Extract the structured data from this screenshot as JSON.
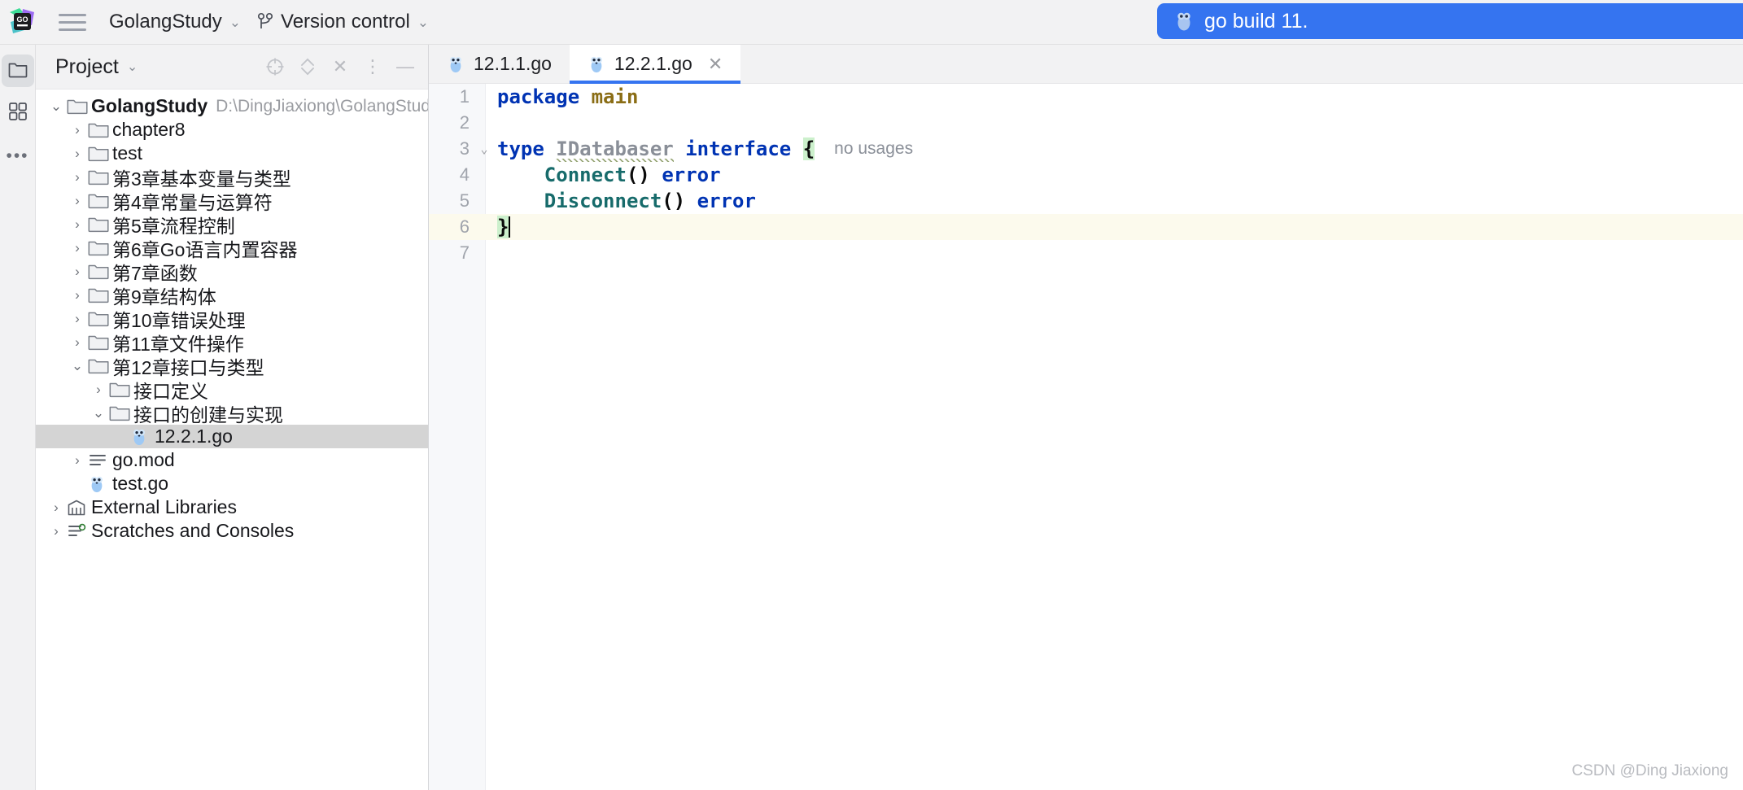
{
  "toolbar": {
    "project_name": "GolangStudy",
    "version_control": "Version control",
    "chevron": "⌄",
    "run_config": "go build 11.",
    "logo_text": "GO"
  },
  "rail": {
    "items": [
      {
        "name": "project-folder",
        "icon": "folder-icon"
      },
      {
        "name": "structure",
        "icon": "grid-icon"
      },
      {
        "name": "more",
        "icon": "ellipsis-icon",
        "glyph": "•••"
      }
    ]
  },
  "panel": {
    "title": "Project",
    "chevron": "⌄",
    "tools": {
      "locate": "crosshair-icon",
      "expand": "expand-collapse-icon",
      "close": "✕",
      "options": "⋮",
      "minimize": "—"
    }
  },
  "tree": {
    "items": [
      {
        "arrow": "⌄",
        "icon": "folder-icon",
        "label": "GolangStudy",
        "path": "D:\\DingJiaxiong\\GolangStudy",
        "indent": 0,
        "bold": true,
        "selected": false
      },
      {
        "arrow": "›",
        "icon": "folder-icon",
        "label": "chapter8",
        "path": "",
        "indent": 1,
        "bold": false,
        "selected": false
      },
      {
        "arrow": "›",
        "icon": "folder-icon",
        "label": "test",
        "path": "",
        "indent": 1,
        "bold": false,
        "selected": false
      },
      {
        "arrow": "›",
        "icon": "folder-icon",
        "label": "第3章基本变量与类型",
        "path": "",
        "indent": 1,
        "bold": false,
        "selected": false
      },
      {
        "arrow": "›",
        "icon": "folder-icon",
        "label": "第4章常量与运算符",
        "path": "",
        "indent": 1,
        "bold": false,
        "selected": false
      },
      {
        "arrow": "›",
        "icon": "folder-icon",
        "label": "第5章流程控制",
        "path": "",
        "indent": 1,
        "bold": false,
        "selected": false
      },
      {
        "arrow": "›",
        "icon": "folder-icon",
        "label": "第6章Go语言内置容器",
        "path": "",
        "indent": 1,
        "bold": false,
        "selected": false
      },
      {
        "arrow": "›",
        "icon": "folder-icon",
        "label": "第7章函数",
        "path": "",
        "indent": 1,
        "bold": false,
        "selected": false
      },
      {
        "arrow": "›",
        "icon": "folder-icon",
        "label": "第9章结构体",
        "path": "",
        "indent": 1,
        "bold": false,
        "selected": false
      },
      {
        "arrow": "›",
        "icon": "folder-icon",
        "label": "第10章错误处理",
        "path": "",
        "indent": 1,
        "bold": false,
        "selected": false
      },
      {
        "arrow": "›",
        "icon": "folder-icon",
        "label": "第11章文件操作",
        "path": "",
        "indent": 1,
        "bold": false,
        "selected": false
      },
      {
        "arrow": "⌄",
        "icon": "folder-icon",
        "label": "第12章接口与类型",
        "path": "",
        "indent": 1,
        "bold": false,
        "selected": false
      },
      {
        "arrow": "›",
        "icon": "folder-icon",
        "label": "接口定义",
        "path": "",
        "indent": 2,
        "bold": false,
        "selected": false
      },
      {
        "arrow": "⌄",
        "icon": "folder-icon",
        "label": "接口的创建与实现",
        "path": "",
        "indent": 2,
        "bold": false,
        "selected": false
      },
      {
        "arrow": "",
        "icon": "go-file-icon",
        "label": "12.2.1.go",
        "path": "",
        "indent": 3,
        "bold": false,
        "selected": true
      },
      {
        "arrow": "›",
        "icon": "mod-file-icon",
        "label": "go.mod",
        "path": "",
        "indent": 1,
        "bold": false,
        "selected": false
      },
      {
        "arrow": "",
        "icon": "go-file-icon",
        "label": "test.go",
        "path": "",
        "indent": 1,
        "bold": false,
        "selected": false
      },
      {
        "arrow": "›",
        "icon": "library-icon",
        "label": "External Libraries",
        "path": "",
        "indent": 0,
        "bold": false,
        "selected": false
      },
      {
        "arrow": "›",
        "icon": "scratches-icon",
        "label": "Scratches and Consoles",
        "path": "",
        "indent": 0,
        "bold": false,
        "selected": false
      }
    ]
  },
  "editor": {
    "tabs": [
      {
        "label": "12.1.1.go",
        "active": false,
        "closable": false
      },
      {
        "label": "12.2.1.go",
        "active": true,
        "closable": true
      }
    ],
    "close_glyph": "✕",
    "code": [
      {
        "num": "1",
        "fold": "",
        "highlight": false,
        "tokens": [
          {
            "text": "package",
            "cls": "kw"
          },
          {
            "text": " ",
            "cls": ""
          },
          {
            "text": "main",
            "cls": "pkg"
          }
        ],
        "inlay": ""
      },
      {
        "num": "2",
        "fold": "",
        "highlight": false,
        "tokens": [],
        "inlay": ""
      },
      {
        "num": "3",
        "fold": "⌄",
        "highlight": false,
        "tokens": [
          {
            "text": "type",
            "cls": "kw"
          },
          {
            "text": " ",
            "cls": ""
          },
          {
            "text": "IDatabaser",
            "cls": "ident squiggle"
          },
          {
            "text": " ",
            "cls": ""
          },
          {
            "text": "interface",
            "cls": "kw"
          },
          {
            "text": " ",
            "cls": ""
          },
          {
            "text": "{",
            "cls": "brace-hl"
          }
        ],
        "inlay": "no usages"
      },
      {
        "num": "4",
        "fold": "",
        "highlight": false,
        "tokens": [
          {
            "text": "    ",
            "cls": ""
          },
          {
            "text": "Connect",
            "cls": "fn"
          },
          {
            "text": "()",
            "cls": "punct"
          },
          {
            "text": " ",
            "cls": ""
          },
          {
            "text": "error",
            "cls": "kw"
          }
        ],
        "inlay": ""
      },
      {
        "num": "5",
        "fold": "",
        "highlight": false,
        "tokens": [
          {
            "text": "    ",
            "cls": ""
          },
          {
            "text": "Disconnect",
            "cls": "fn"
          },
          {
            "text": "()",
            "cls": "punct"
          },
          {
            "text": " ",
            "cls": ""
          },
          {
            "text": "error",
            "cls": "kw"
          }
        ],
        "inlay": ""
      },
      {
        "num": "6",
        "fold": "",
        "highlight": true,
        "caret": true,
        "tokens": [
          {
            "text": "}",
            "cls": "brace-hl"
          }
        ],
        "inlay": ""
      },
      {
        "num": "7",
        "fold": "",
        "highlight": false,
        "tokens": [],
        "inlay": ""
      }
    ]
  },
  "watermark": "CSDN @Ding Jiaxiong",
  "colors": {
    "accent": "#3574f0",
    "keyword": "#0033b3",
    "function": "#176b6b",
    "package": "#8a6d15",
    "identifier": "#8a8f98",
    "selection": "#d4d4d4",
    "line_highlight": "#fcfaed"
  }
}
